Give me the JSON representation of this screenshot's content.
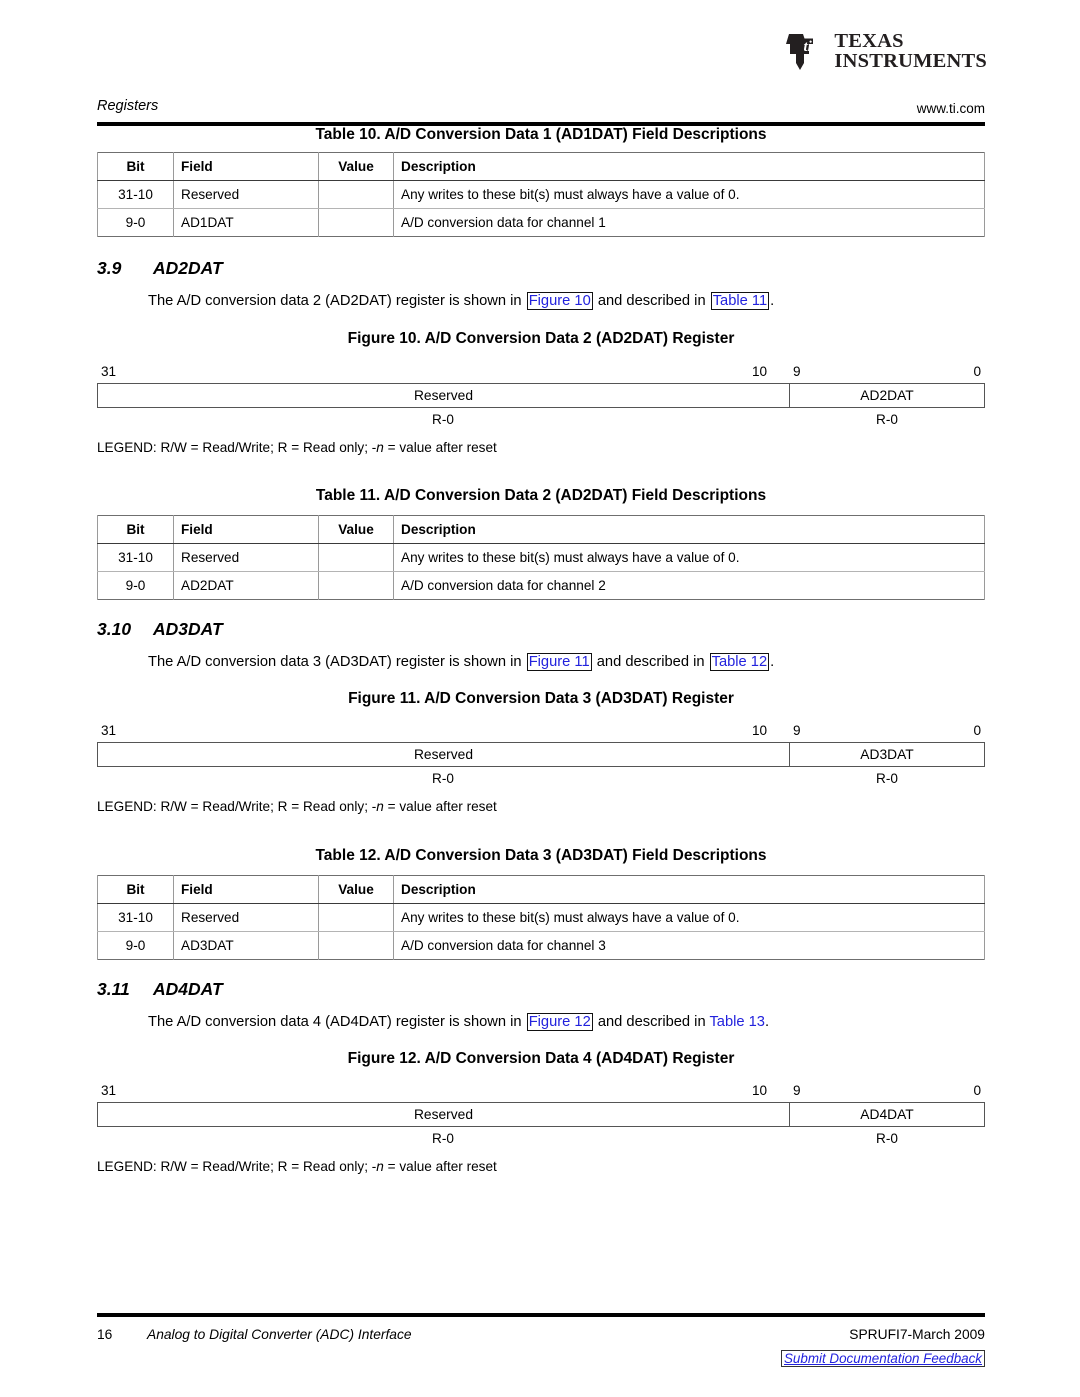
{
  "header": {
    "logo_alt": "Texas Instruments",
    "logo_line1": "TEXAS",
    "logo_line2": "INSTRUMENTS",
    "running_head": "Registers",
    "url": "www.ti.com"
  },
  "table10": {
    "caption": "Table 10. A/D Conversion Data 1 (AD1DAT) Field Descriptions",
    "columns": [
      "Bit",
      "Field",
      "Value",
      "Description"
    ],
    "rows": [
      {
        "bit": "31-10",
        "field": "Reserved",
        "value": "",
        "desc": "Any writes to these bit(s) must always have a value of 0."
      },
      {
        "bit": "9-0",
        "field": "AD1DAT",
        "value": "",
        "desc": "A/D conversion data for channel 1"
      }
    ]
  },
  "section39": {
    "number": "3.9",
    "title": "AD2DAT",
    "para_1": "The A/D conversion data 2 (AD2DAT) register is shown in ",
    "link_figure": "Figure 10",
    "para_2": " and described in ",
    "link_table": "Table 11",
    "para_3": "."
  },
  "figure10": {
    "caption": "Figure 10. A/D Conversion Data 2 (AD2DAT) Register",
    "bit_high": "31",
    "bit_split_left": "10",
    "bit_split_right": "9",
    "bit_low": "0",
    "reserved_label": "Reserved",
    "field_label": "AD2DAT",
    "reserved_access": "R-0",
    "field_access": "R-0",
    "legend_prefix": "LEGEND: R/W = Read/Write; R = Read only; -",
    "legend_italic": "n",
    "legend_suffix": " = value after reset"
  },
  "table11": {
    "caption": "Table 11. A/D Conversion Data 2 (AD2DAT) Field Descriptions",
    "columns": [
      "Bit",
      "Field",
      "Value",
      "Description"
    ],
    "rows": [
      {
        "bit": "31-10",
        "field": "Reserved",
        "value": "",
        "desc": "Any writes to these bit(s) must always have a value of 0."
      },
      {
        "bit": "9-0",
        "field": "AD2DAT",
        "value": "",
        "desc": "A/D conversion data for channel 2"
      }
    ]
  },
  "section310": {
    "number": "3.10",
    "title": "AD3DAT",
    "para_1": "The A/D conversion data 3 (AD3DAT) register is shown in ",
    "link_figure": "Figure 11",
    "para_2": " and described in ",
    "link_table": "Table 12",
    "para_3": "."
  },
  "figure11": {
    "caption": "Figure 11. A/D Conversion Data 3 (AD3DAT) Register",
    "bit_high": "31",
    "bit_split_left": "10",
    "bit_split_right": "9",
    "bit_low": "0",
    "reserved_label": "Reserved",
    "field_label": "AD3DAT",
    "reserved_access": "R-0",
    "field_access": "R-0",
    "legend_prefix": "LEGEND: R/W = Read/Write; R = Read only; -",
    "legend_italic": "n",
    "legend_suffix": " = value after reset"
  },
  "table12": {
    "caption": "Table 12. A/D Conversion Data 3 (AD3DAT) Field Descriptions",
    "columns": [
      "Bit",
      "Field",
      "Value",
      "Description"
    ],
    "rows": [
      {
        "bit": "31-10",
        "field": "Reserved",
        "value": "",
        "desc": "Any writes to these bit(s) must always have a value of 0."
      },
      {
        "bit": "9-0",
        "field": "AD3DAT",
        "value": "",
        "desc": "A/D conversion data for channel 3"
      }
    ]
  },
  "section311": {
    "number": "3.11",
    "title": "AD4DAT",
    "para_1": "The A/D conversion data 4 (AD4DAT) register is shown in ",
    "link_figure": "Figure 12",
    "para_2": " and described in ",
    "link_table": "Table 13",
    "para_3": "."
  },
  "figure12": {
    "caption": "Figure 12. A/D Conversion Data 4 (AD4DAT) Register",
    "bit_high": "31",
    "bit_split_left": "10",
    "bit_split_right": "9",
    "bit_low": "0",
    "reserved_label": "Reserved",
    "field_label": "AD4DAT",
    "reserved_access": "R-0",
    "field_access": "R-0",
    "legend_prefix": "LEGEND: R/W = Read/Write; R = Read only; -",
    "legend_italic": "n",
    "legend_suffix": " = value after reset"
  },
  "footer": {
    "page_number": "16",
    "doc_title": "Analog to Digital Converter (ADC) Interface",
    "doc_number": "SPRUFI7-March 2009",
    "feedback": "Submit Documentation Feedback"
  },
  "colors": {
    "link": "#2222dd",
    "rule": "#000000",
    "table_border": "#6f6f6f"
  }
}
